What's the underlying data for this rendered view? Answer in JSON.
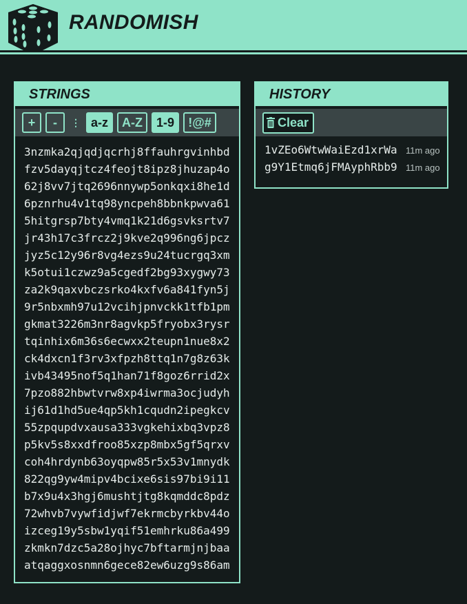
{
  "app": {
    "title": "RANDOMISH",
    "logo_icon": "dice-icon",
    "accent": "#8fe3c8",
    "background": "#141b1b"
  },
  "strings_panel": {
    "title": "STRINGS",
    "toolbar": {
      "add_label": "+",
      "remove_label": "-",
      "drag_icon": "drag-handle-icon",
      "options": [
        {
          "label": "a-z",
          "active": true
        },
        {
          "label": "A-Z",
          "active": false
        },
        {
          "label": "1-9",
          "active": true
        },
        {
          "label": "!@#",
          "active": false
        }
      ]
    },
    "items": [
      "3nzmka2qjqdjqcrhj8ffauhrgvinhbd",
      "fzv5dayqjtcz4feojt8ipz8jhuzap4o",
      "62j8vv7jtq2696nnywp5onkqxi8he1d",
      "6pznrhu4v1tq98yncpeh8bbnkpwva61",
      "5hitgrsp7bty4vmq1k21d6gsvksrtv7",
      "jr43h17c3frcz2j9kve2q996ng6jpcz",
      "jyz5c12y96r8vg4ezs9u24tucrgq3xm",
      "k5otui1czwz9a5cgedf2bg93xygwy73",
      "za2k9qaxvbczsrko4kxfv6a841fyn5j",
      "9r5nbxmh97u12vcihjpnvckk1tfb1pm",
      "gkmat3226m3nr8agvkp5fryobx3rysr",
      "tqinhix6m36s6ecwxx2teupn1nue8x2",
      "ck4dxcn1f3rv3xfpzh8ttq1n7g8z63k",
      "ivb43495nof5q1han71f8goz6rrid2x",
      "7pzo882hbwtvrw8xp4iwrma3ocjudyh",
      "ij61d1hd5ue4qp5kh1cqudn2ipegkcv",
      "55zpqupdvxausa333vgkehixbq3vpz8",
      "p5kv5s8xxdfroo85xzp8mbx5gf5qrxv",
      "coh4hrdynb63oyqpw85r5x53v1mnydk",
      "822qg9yw4mipv4bcixe6sis97bi9i11",
      "b7x9u4x3hgj6mushtjtg8kqmddc8pdz",
      "72whvb7vywfidjwf7ekrmcbyrkbv44o",
      "izceg19y5sbw1yqif51emhrku86a499",
      "zkmkn7dzc5a28ojhyc7bftarmjnjbaa",
      "atqaggxosnmn6gece82ew6uzg9s86am"
    ]
  },
  "history_panel": {
    "title": "HISTORY",
    "clear_label": "Clear",
    "clear_icon": "trash-icon",
    "items": [
      {
        "value": "1vZEo6WtwWaiEzd1xrWa",
        "time": "11m ago"
      },
      {
        "value": "g9Y1Etmq6jFMAyphRbb9",
        "time": "11m ago"
      }
    ]
  }
}
